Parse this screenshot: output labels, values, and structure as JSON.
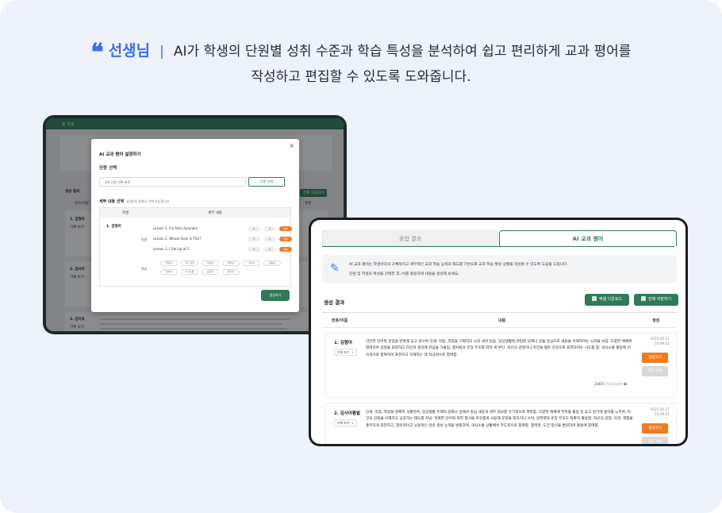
{
  "headline": {
    "speaker": "선생님",
    "separator": "|",
    "line1": "AI가 학생의 단원별 성취 수준과 학습 특성을 분석하여 쉽고 편리하게 교과 평어를",
    "line2": "작성하고 편집할 수 있도록 도와줍니다."
  },
  "back_window": {
    "topbar": "홈  학생",
    "bg_section_title": "생성 결과",
    "bg_col_name": "번호/이름",
    "bg_col_gen": "생성",
    "bg_save_all": "전체 저장하기",
    "bg_students": [
      "1. 김형아",
      "2. 김서아",
      "3. 김지호"
    ],
    "bg_record_chip": "기록 보기",
    "modal": {
      "title": "AI 교과 평어 설정하기",
      "close": "×",
      "unit_section": "단원 선택",
      "unit_input": "3개 단원 선택 완료",
      "unit_button": "단원 선택",
      "detail_section": "세부 내용 선택",
      "detail_hint": "높/중/하 중에서 선택 가능합니다.",
      "col_student": "학생",
      "col_detail": "세부 내용",
      "student": "1. 김형아",
      "unit_label": "단원",
      "trait_label": "특성",
      "lessons": [
        "Lesson 1. I'm from Australia",
        "Lesson 2. Whose Sock Is This?",
        "Lesson 3. I Get Up at 5"
      ],
      "levels": [
        "하",
        "중",
        "높음"
      ],
      "traits": [
        "책임감",
        "자기 관리",
        "성실함",
        "배려심",
        "리더십",
        "협동심",
        "창의성",
        "의사소통",
        "공감력",
        "탐구력"
      ],
      "generate": "생성하기"
    }
  },
  "front_window": {
    "tabs": [
      "종합 결과",
      "AI 교과 평어"
    ],
    "active_tab": "AI 교과 평어",
    "info_line1": "AI 교과 평어는 학생이다의 구체적이고 세부적인 교과 학습 능력과 태도를 기반으로 교과 학습 발달 상황을 작성할 수 있도록 도움을 드립니다.",
    "info_line2": "단원 및 학생의 특성을 선택한 후, AI를 활용하여 내용을 생성해 보세요.",
    "result_title": "생성 결과",
    "btn_download": "엑셀 다운로드",
    "btn_save_all": "전체 저장하기",
    "col_name": "번호/이름",
    "col_content": "내용",
    "col_generate": "생성",
    "rows": [
      {
        "name": "1. 김형아",
        "record_label": "기록 보기",
        "record_count": "1",
        "content": "간단한 단어와 문장을 반복해 듣고 읽으며 강세, 리듬, 억양을 구별하고 소리 내어 읽음. 일상생활에 관련된 담화나 글을 중심으로 내용을 이해하려는 노력을 보임. 다양한 매체에 참여하며 감정을 표현하고 타인의 생각에 관심을 기울임. 철자법과 문장 부호를 따라 써 본다. 자신의 감정이나 먹건을 짧은 문장으로 표현하려는 시도를 함. 의사소통 활동에 지속적으로 참여하며 표현하고 이해하는 데 적극적으로 참여함.",
        "bytes": "226자",
        "bytes_detail": "(554 byte)",
        "date": "2025.05.27",
        "time": "14:48:02",
        "generate": "생성하기",
        "save": "저장 완료"
      },
      {
        "name": "2. 김서아통밭",
        "record_label": "기록 보기",
        "record_count": "1",
        "content": "강세, 리듬, 억양을 정확히 식별하며, 일상생활 주제의 담화나 글에서 중심 내용과 세부 정보를 유기적으로 파악함. 다양한 매체에 한꺼풀 활용 등 듣고 읽기에 흥미를 느끼며, 타인의 감정을 이해하고 공감하는 태도를 지님. 적절한 단어와 표현 형식을 자유롭게 사용해 문장을 말하거나 쓰며, 알파벳과 문장 부호도 정확히 활용함. 자신의 감정, 의견, 경험을 풍부하게 표현하고, 창의적이고 능동적인 의미 생성 능력을 발휘하며, 의사소통 상황에서 주도적으로 참여함. 협력적, 도전 정신을 발휘하며 활동에 참여함.",
        "date": "2025.05.27",
        "time": "14:48:02",
        "generate": "생성하기",
        "save": "저장 완료"
      }
    ]
  },
  "colors": {
    "accent_blue": "#3b6fe0",
    "brand_green": "#2f7a57",
    "orange": "#f27b22",
    "background": "#edf2fb"
  }
}
